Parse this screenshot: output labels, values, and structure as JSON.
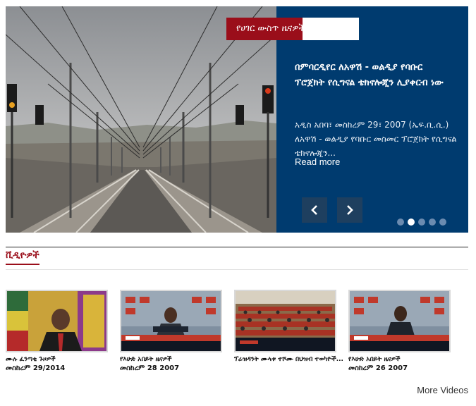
{
  "slider": {
    "category": "የሀገር ውስጥ ዜናዎች",
    "headline": "በምባርዲየር ለአዋሽ - ወልዲያ የባቡር ፕሮጀክት የሲግናል ቴክኖሎጂን ሊያቀርብ ነው",
    "excerpt": "አዲስ አበባ፣ መስከረም 29፣ 2007 (ኤፍ.ቢ.ሲ.) ለአዋሽ - ወልዲያ የባቡር መስመር ፕሮጀክት የሲግናል ቴክኖሎጂን...",
    "read_more": "Read more",
    "active_dot": 1,
    "dot_count": 5
  },
  "videos_section": {
    "title": "ቪዲዮዎች",
    "more": "More Videos",
    "items": [
      {
        "title": "ሙሉ ፈንጣቂ ጉዞዎች",
        "date": "መስከረም 29/2014"
      },
      {
        "title": "የእሁድ አበይት ዜናዎች",
        "date": "መስከረም 28 2007"
      },
      {
        "title": "ፕሬዝዳንት ሙላቱ ተሾሙ በህዝብ ተወካዮች...",
        "date": ""
      },
      {
        "title": "የእሁድ አበይት ዜናዎች",
        "date": "መስከረም 26 2007"
      }
    ]
  },
  "colors": {
    "brand_red": "#9a0e1a",
    "panel_blue": "#003b6f"
  },
  "icons": {
    "prev": "chevron-left-icon",
    "next": "chevron-right-icon"
  }
}
